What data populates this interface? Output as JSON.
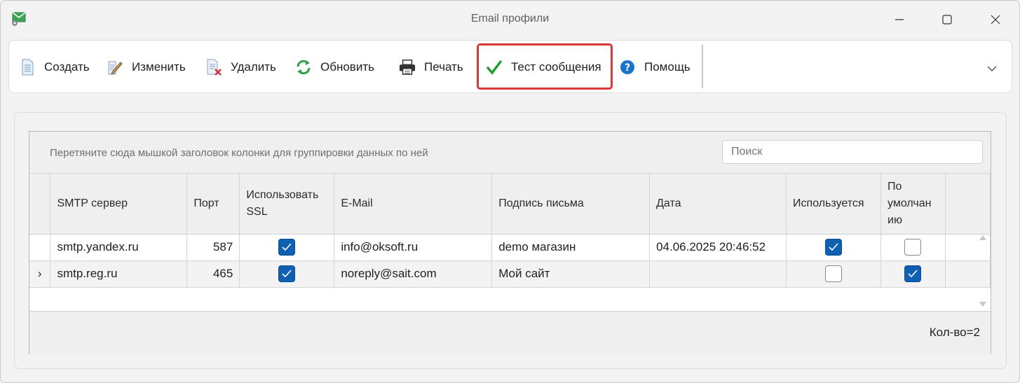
{
  "window": {
    "title": "Email профили",
    "app_icon": "envelope-gear-icon",
    "controls": [
      "minimize-icon",
      "maximize-icon",
      "close-icon"
    ]
  },
  "toolbar": {
    "buttons": [
      {
        "label": "Создать",
        "icon": "new-document-icon"
      },
      {
        "label": "Изменить",
        "icon": "edit-document-icon"
      },
      {
        "label": "Удалить",
        "icon": "delete-document-icon"
      },
      {
        "label": "Обновить",
        "icon": "refresh-icon"
      },
      {
        "label": "Печать",
        "icon": "printer-icon"
      },
      {
        "label": "Тест сообщения",
        "icon": "checkmark-icon"
      },
      {
        "label": "Помощь",
        "icon": "help-icon"
      }
    ],
    "highlighted_button": "Тест сообщения",
    "highlight_color": "#d9373a",
    "more_icon": "chevron-down-icon"
  },
  "grid": {
    "group_hint": "Перетяните сюда мышкой заголовок колонки для группировки данных по ней",
    "search_placeholder": "Поиск",
    "columns": [
      "SMTP сервер",
      "Порт",
      "Использовать SSL",
      "E-Mail",
      "Подпись письма",
      "Дата",
      "Используется",
      "По умолчанию"
    ],
    "column_header_display": {
      "ssl": [
        "Использовать",
        "SSL"
      ],
      "default": [
        "По",
        "умолчан",
        "ию"
      ]
    },
    "rows": [
      {
        "smtp": "smtp.yandex.ru",
        "port": "587",
        "ssl": true,
        "email": "info@oksoft.ru",
        "signature": "demo магазин",
        "date": "04.06.2025 20:46:52",
        "used": true,
        "default": false,
        "current": false
      },
      {
        "smtp": "smtp.reg.ru",
        "port": "465",
        "ssl": true,
        "email": "noreply@sait.com",
        "signature": "Мой сайт",
        "date": "",
        "used": false,
        "default": true,
        "current": true
      }
    ],
    "row_indicator": "›",
    "checkbox_color": "#0f5fb3",
    "footer_count": "Кол-во=2"
  }
}
